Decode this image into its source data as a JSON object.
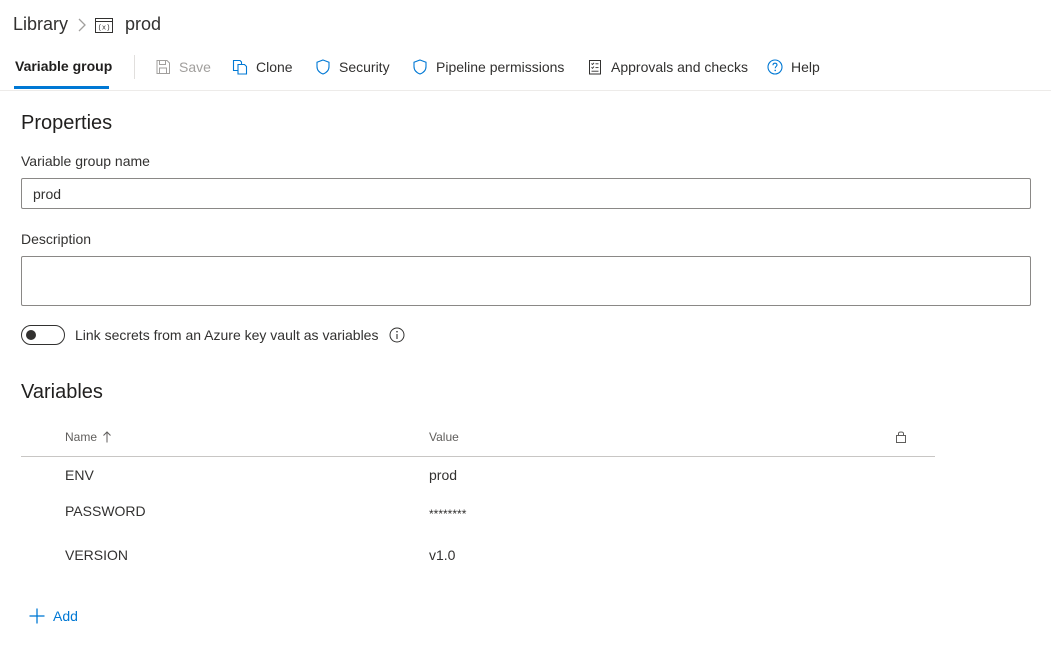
{
  "breadcrumb": {
    "root": "Library",
    "current": "prod"
  },
  "toolbar": {
    "active_tab": "Variable group",
    "save_label": "Save",
    "clone_label": "Clone",
    "security_label": "Security",
    "pipeline_permissions_label": "Pipeline permissions",
    "approvals_label": "Approvals and checks",
    "help_label": "Help",
    "icons": [
      "save-icon",
      "clone-icon",
      "shield-icon",
      "shield-icon",
      "checklist-icon",
      "help-icon"
    ]
  },
  "properties": {
    "title": "Properties",
    "name_label": "Variable group name",
    "name_value": "prod",
    "description_label": "Description",
    "description_value": "",
    "keyvault_label": "Link secrets from an Azure key vault as variables",
    "keyvault_enabled": false
  },
  "variables": {
    "title": "Variables",
    "columns": {
      "name": "Name",
      "value": "Value"
    },
    "sort": "name-ascending",
    "rows": [
      {
        "name": "ENV",
        "value": "prod"
      },
      {
        "name": "PASSWORD",
        "value": "********"
      },
      {
        "name": "VERSION",
        "value": "v1.0"
      }
    ],
    "add_label": "Add"
  },
  "colors": {
    "accent": "#0078d4",
    "text": "#323130",
    "disabled": "#a19f9d"
  }
}
